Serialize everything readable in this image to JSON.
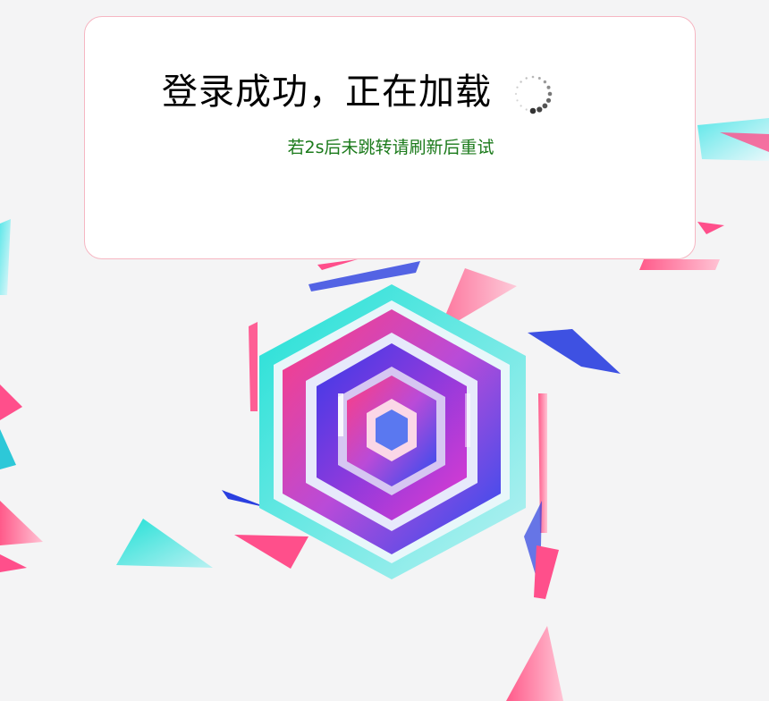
{
  "loader": {
    "title": "登录成功，正在加载",
    "hint": "若2s后未跳转请刷新后重试"
  },
  "icons": {
    "spinner": "loading-spinner-icon"
  },
  "colors": {
    "background": "#f4f4f5",
    "card_background": "#ffffff",
    "card_border": "#f6b6c2",
    "title_text": "#000000",
    "hint_text": "#1b7a1b"
  }
}
